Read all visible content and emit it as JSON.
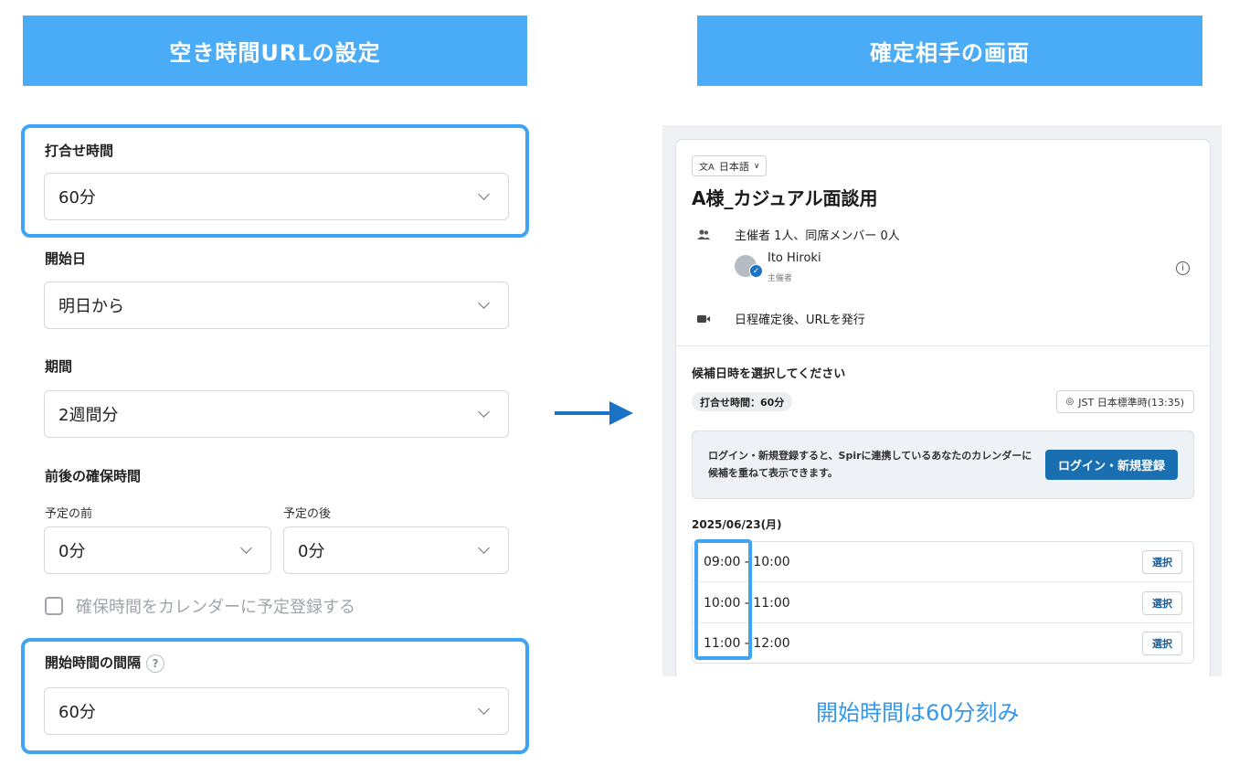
{
  "left_panel": {
    "banner": "空き時間URLの設定",
    "meeting_duration": {
      "label": "打合せ時間",
      "value": "60分"
    },
    "start_date": {
      "label": "開始日",
      "value": "明日から"
    },
    "period": {
      "label": "期間",
      "value": "2週間分"
    },
    "buffer": {
      "label": "前後の確保時間",
      "before_label": "予定の前",
      "before_value": "0分",
      "after_label": "予定の後",
      "after_value": "0分"
    },
    "register_checkbox": {
      "label": "確保時間をカレンダーに予定登録する",
      "checked": false
    },
    "start_interval": {
      "label": "開始時間の間隔",
      "help": "?",
      "value": "60分"
    }
  },
  "right_panel": {
    "banner": "確定相手の画面",
    "language": "日本語",
    "event_title": "A様_カジュアル面談用",
    "members_summary": "主催者 1人、同席メンバー 0人",
    "organizer": {
      "name": "Ito Hiroki",
      "role": "主催者"
    },
    "meeting_url_note": "日程確定後、URLを発行",
    "select_heading": "候補日時を選択してください",
    "duration_pill": "打合せ時間：60分",
    "timezone": "JST 日本標準時(13:35)",
    "login_prompt": "ログイン・新規登録すると、Spirに連携しているあなたのカレンダーに候補を重ねて表示できます。",
    "login_button": "ログイン・新規登録",
    "date": "2025/06/23(月)",
    "slots": [
      {
        "time": "09:00 - 10:00",
        "button": "選択"
      },
      {
        "time": "10:00 - 11:00",
        "button": "選択"
      },
      {
        "time": "11:00 - 12:00",
        "button": "選択"
      }
    ]
  },
  "caption": "開始時間は60分刻み",
  "colors": {
    "banner": "#4aabf7",
    "highlight": "#3fa4f3",
    "primary_button": "#1a6fb0",
    "caption": "#3597ea"
  }
}
